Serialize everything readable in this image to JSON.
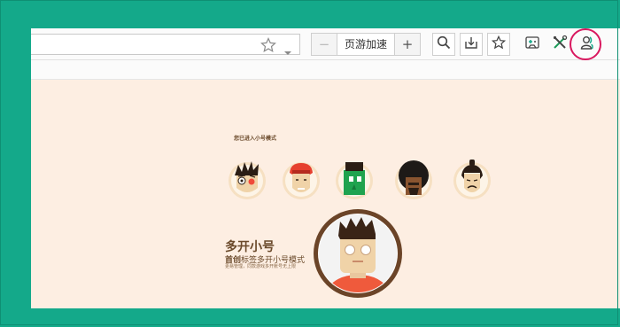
{
  "toolbar": {
    "zoom_label": "页游加速",
    "minus_label": "−",
    "plus_label": "+"
  },
  "content": {
    "mode_text": "您已进入小号模式",
    "title": "多开小号",
    "subtitle_bold": "首创",
    "subtitle_rest": "标签多开小号模式",
    "description": "更易管理，同款游戏多开账号无上限"
  },
  "colors": {
    "frame_bg": "#14a98a",
    "content_bg": "#fdeee2",
    "highlight_ring": "#d9185f",
    "text_brown": "#6b4a2b"
  },
  "icons": [
    "star-icon",
    "dropdown-arrow-icon",
    "search-icon",
    "download-icon",
    "favorite-star-icon",
    "gamepad-icon",
    "tools-icon",
    "user-icon"
  ]
}
